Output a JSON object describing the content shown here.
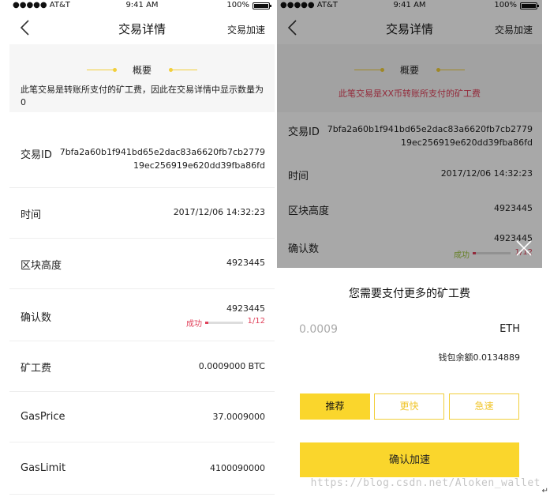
{
  "status_bar": {
    "carrier": "●●●●● AT&T",
    "time": "9:41 AM",
    "battery": "100%"
  },
  "left": {
    "nav": {
      "title": "交易详情",
      "action": "交易加速"
    },
    "summary": {
      "heading": "概要",
      "note": "此笔交易是转账所支付的矿工费，因此在交易详情中显示数量为0"
    },
    "rows": {
      "txid": {
        "label": "交易ID",
        "value": "7bfa2a60b1f941bd65e2dac83a6620fb7cb277919ec256919e620dd39fba86fd"
      },
      "time": {
        "label": "时间",
        "value": "2017/12/06  14:32:23"
      },
      "block": {
        "label": "区块高度",
        "value": "4923445"
      },
      "confirm": {
        "label": "确认数",
        "value": "4923445",
        "status": "成功",
        "fraction": "1/12",
        "progress": 0.083
      },
      "fee": {
        "label": "矿工费",
        "value": "0.0009000 BTC"
      },
      "gasprice": {
        "label": "GasPrice",
        "value": "37.0009000"
      },
      "gaslimit": {
        "label": "GasLimit",
        "value": "4100090000"
      }
    }
  },
  "right": {
    "nav": {
      "title": "交易详情",
      "action": "交易加速"
    },
    "summary": {
      "heading": "概要",
      "note": "此笔交易是XX币转账所支付的矿工费"
    },
    "rows": {
      "txid": {
        "label": "交易ID",
        "value": "7bfa2a60b1f941bd65e2dac83a6620fb7cb277919ec256919e620dd39fba86fd"
      },
      "time": {
        "label": "时间",
        "value": "2017/12/06  14:32:23"
      },
      "block": {
        "label": "区块高度",
        "value": "4923445"
      },
      "confirm": {
        "label": "确认数",
        "value": "4923445",
        "status": "成功",
        "fraction": "1/12",
        "progress": 0.083
      }
    },
    "sheet": {
      "title": "您需要支付更多的矿工费",
      "fee_placeholder": "0.0009",
      "unit": "ETH",
      "balance": "钱包余额0.0134889",
      "options": [
        "推荐",
        "更快",
        "急速"
      ],
      "selected_option": "推荐",
      "confirm_label": "确认加速"
    }
  },
  "watermark": "https://blog.csdn.net/Aloken_wallet",
  "colors": {
    "accent": "#fad62c",
    "danger": "#e0415a"
  }
}
